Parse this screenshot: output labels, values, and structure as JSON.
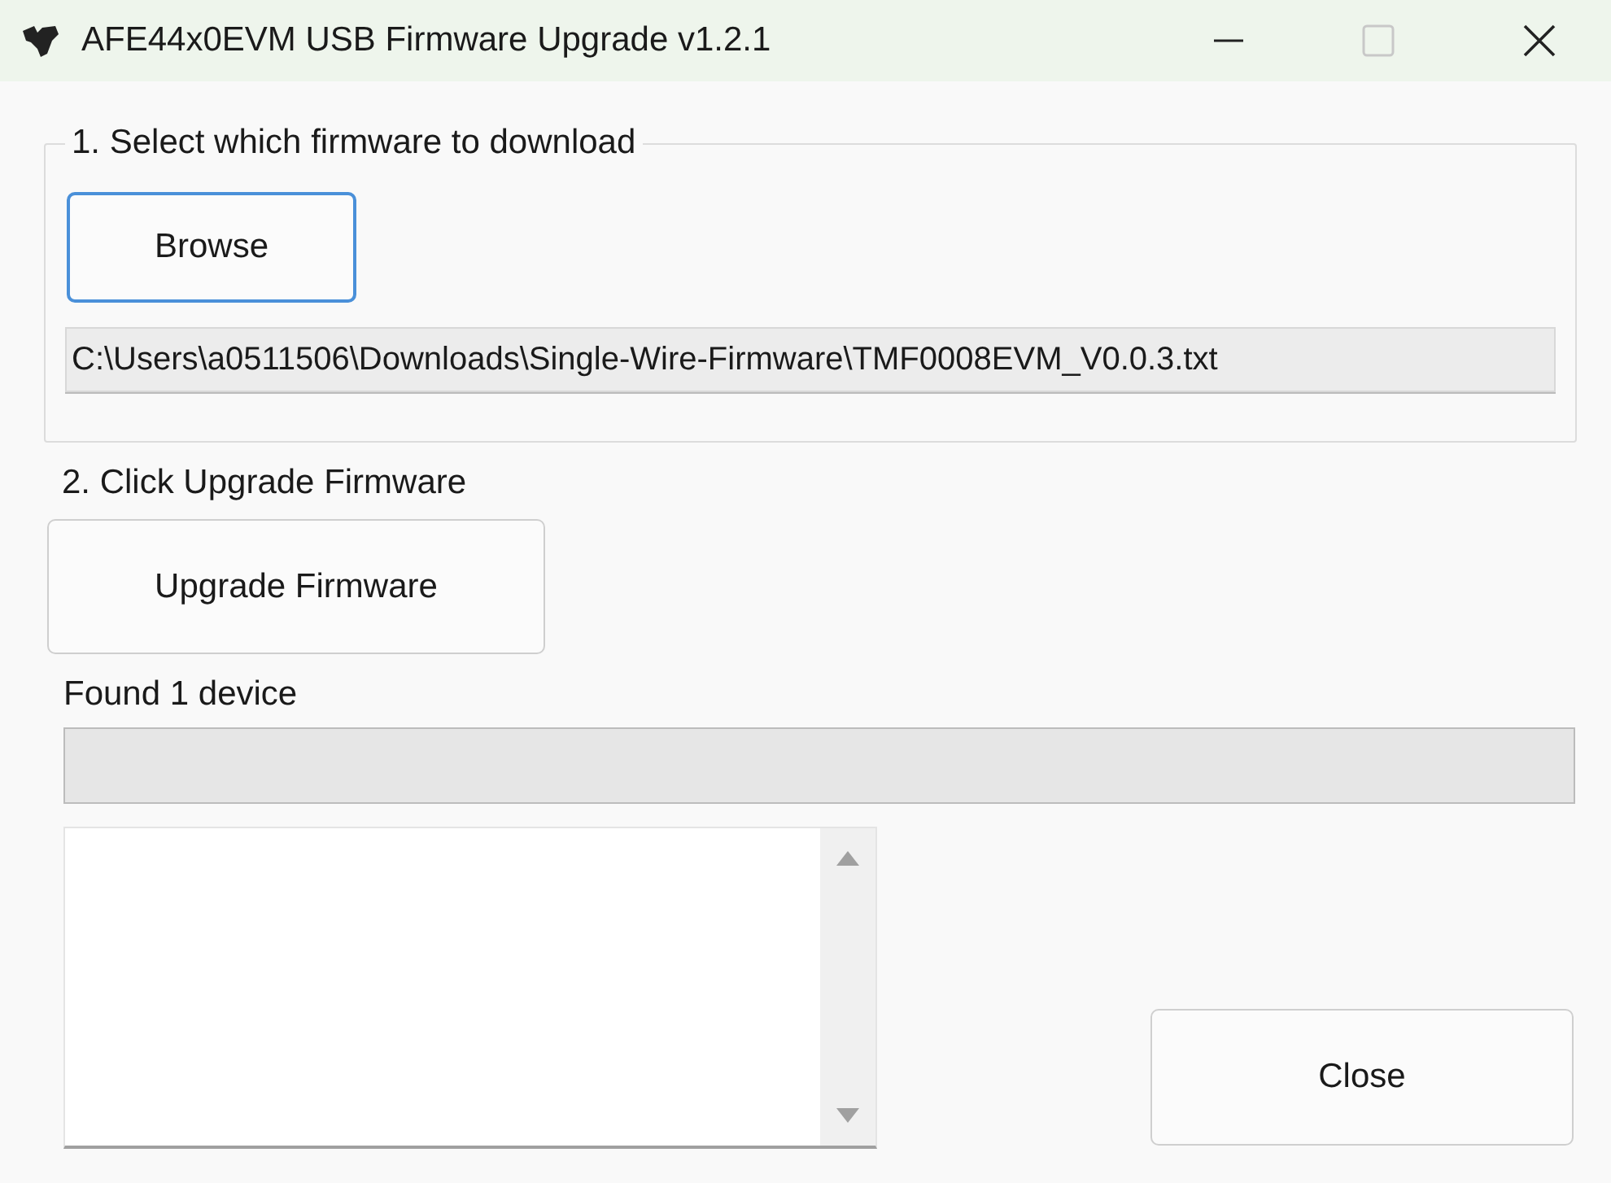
{
  "window": {
    "title": "AFE44x0EVM USB Firmware Upgrade v1.2.1"
  },
  "step1": {
    "label": "1. Select which firmware to download",
    "browse_button": "Browse",
    "path": "C:\\Users\\a0511506\\Downloads\\Single-Wire-Firmware\\TMF0008EVM_V0.0.3.txt"
  },
  "step2": {
    "label": "2. Click Upgrade Firmware",
    "upgrade_button": "Upgrade Firmware"
  },
  "status": "Found 1 device",
  "close_button": "Close"
}
